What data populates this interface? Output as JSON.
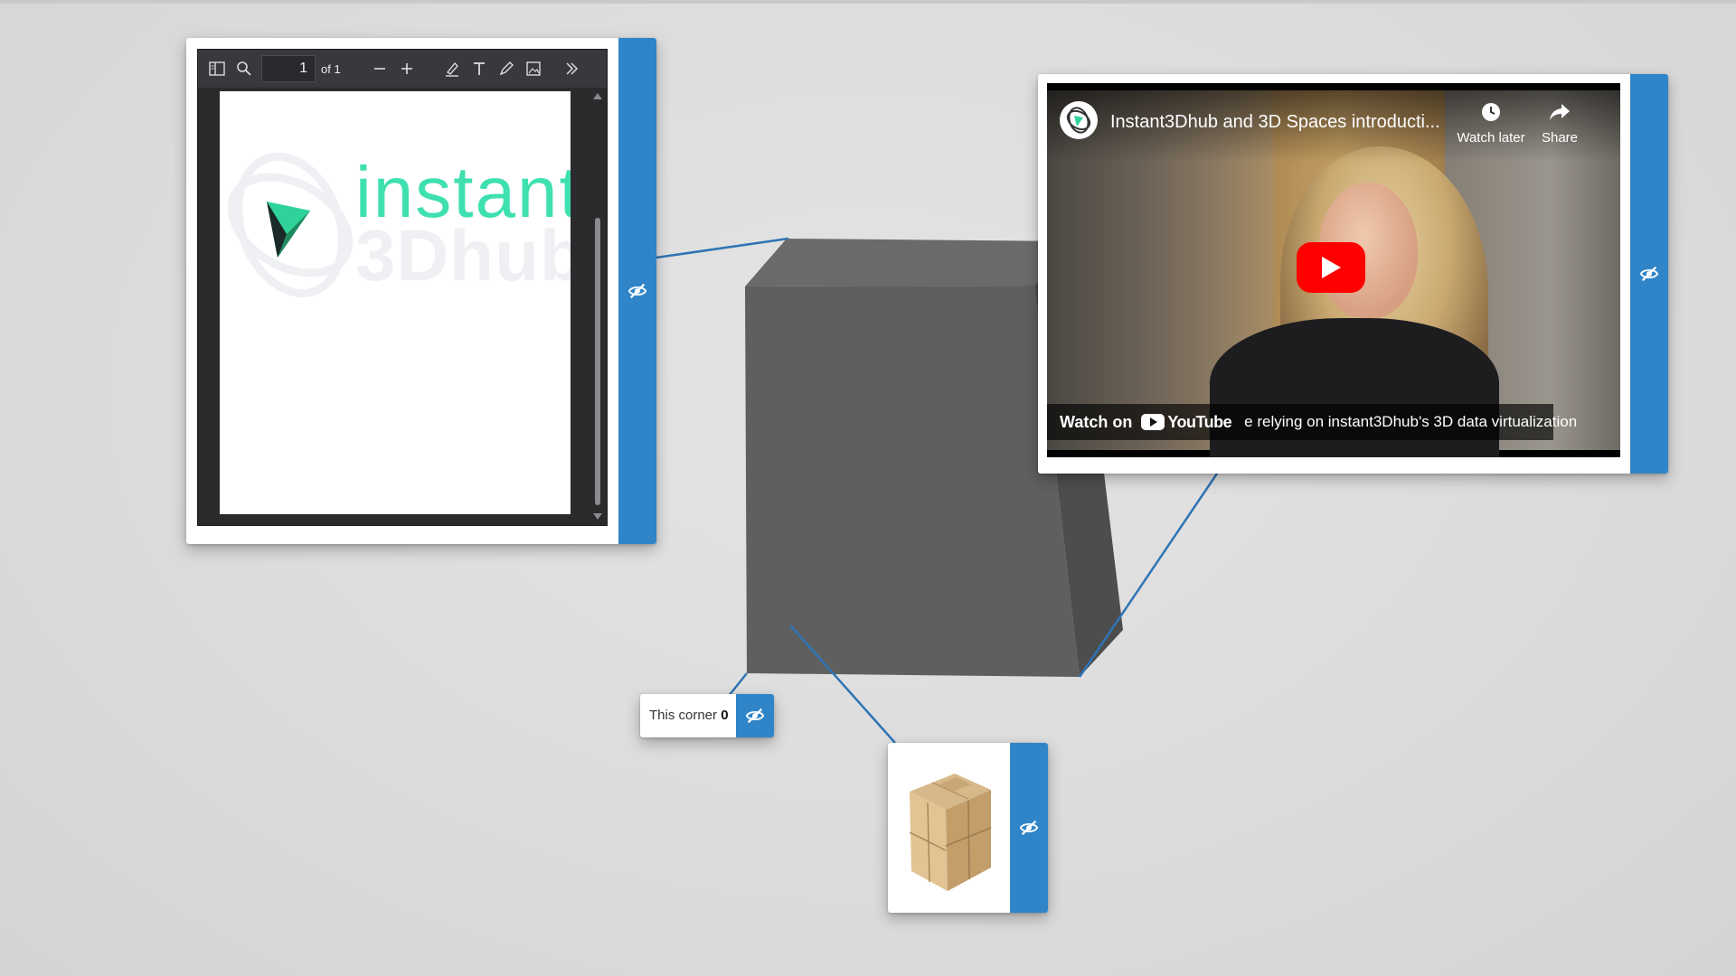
{
  "pdf": {
    "page_number": "1",
    "page_total": "of 1",
    "logo_word_top": "instant",
    "logo_word_bottom": "3Dhub",
    "toolbar_icons": [
      "sidebar-toggle-icon",
      "search-icon",
      "zoom-out-icon",
      "zoom-in-icon",
      "highlight-icon",
      "text-icon",
      "draw-icon",
      "image-icon",
      "more-tools-icon"
    ]
  },
  "video": {
    "title": "Instant3Dhub and 3D Spaces introducti...",
    "watch_later_label": "Watch later",
    "share_label": "Share",
    "watch_on_label": "Watch on",
    "youtube_word": "YouTube",
    "caption": "e relying on instant3Dhub's 3D data virtualization"
  },
  "annotation": {
    "label_prefix": "This corner ",
    "label_value": "0"
  },
  "colors": {
    "accent": "#3085c8",
    "connector": "#2f74b5",
    "cube_front": "#5f5f5f",
    "cube_side": "#4d4d4d",
    "cube_top": "#6a6a6a",
    "youtube_red": "#ff0000",
    "brand_green": "#3fe0b0"
  },
  "icons": {
    "hide_toggle": "eye-slash-icon"
  }
}
